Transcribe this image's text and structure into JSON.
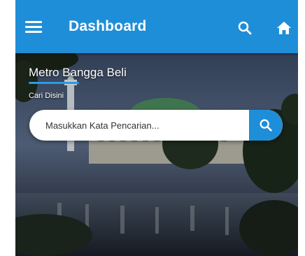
{
  "appbar": {
    "title": "Dashboard",
    "menu_icon": "menu-icon",
    "search_icon": "search-icon",
    "home_icon": "home-icon",
    "color": "#1f8ed8"
  },
  "hero": {
    "title": "Metro Bangga Beli",
    "subtitle": "Cari Disini",
    "accent": "#2a9ae8"
  },
  "search": {
    "placeholder": "Masukkan Kata Pencarian...",
    "button_icon": "search-icon"
  }
}
